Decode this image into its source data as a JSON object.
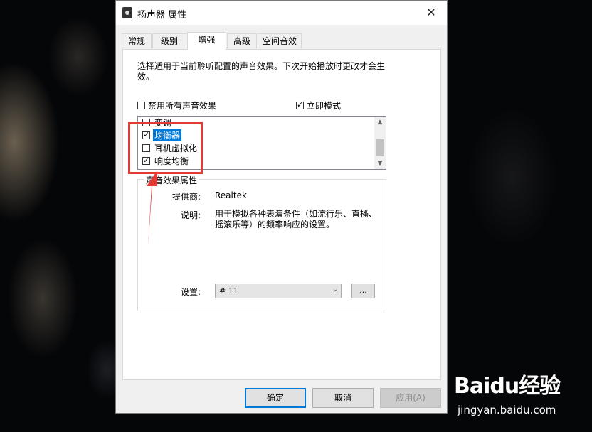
{
  "window": {
    "title": "扬声器 属性",
    "close_glyph": "✕"
  },
  "tabs": [
    {
      "label": "常规",
      "active": false
    },
    {
      "label": "级别",
      "active": false
    },
    {
      "label": "增强",
      "active": true
    },
    {
      "label": "高级",
      "active": false
    },
    {
      "label": "空间音效",
      "active": false
    }
  ],
  "panel": {
    "description_line1": "选择适用于当前聆听配置的声音效果。下次开始播放时更改才会生",
    "description_line2": "效。",
    "disable_all_label": "禁用所有声音效果",
    "disable_all_checked": false,
    "immediate_mode_label": "立即模式",
    "immediate_mode_checked": true
  },
  "effects_list": [
    {
      "label": "变调",
      "checked": false,
      "selected": false
    },
    {
      "label": "均衡器",
      "checked": true,
      "selected": true
    },
    {
      "label": "耳机虚拟化",
      "checked": false,
      "selected": false
    },
    {
      "label": "响度均衡",
      "checked": true,
      "selected": false
    }
  ],
  "properties_group": {
    "title": "声音效果属性",
    "provider_label": "提供商:",
    "provider_value": "Realtek",
    "description_label": "说明:",
    "description_line1": "用于模拟各种表演条件（如流行乐、直播、",
    "description_line2": "摇滚乐等）的频率响应的设置。",
    "setting_label": "设置:",
    "setting_value": "# 11",
    "more_button": "..."
  },
  "buttons": {
    "ok": "确定",
    "cancel": "取消",
    "apply": "应用(A)"
  },
  "watermark": {
    "logo": "Baidu经验",
    "site": "jingyan.baidu.com"
  },
  "icons": {
    "speaker": "speaker-icon",
    "scroll_up": "▲",
    "scroll_down": "▼",
    "dropdown": "⌄"
  },
  "colors": {
    "selection": "#0078d7",
    "annotation": "#e53935"
  }
}
